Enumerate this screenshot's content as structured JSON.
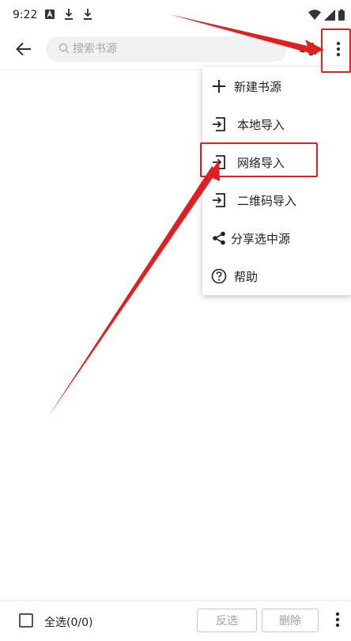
{
  "status_bar": {
    "time": "9:22",
    "left_icons": [
      "a-notification-icon",
      "download-icon",
      "download-icon"
    ],
    "right_icons": [
      "wifi-icon",
      "signal-icon",
      "battery-icon"
    ]
  },
  "toolbar": {
    "search_placeholder": "搜索书源",
    "icons": [
      "back-arrow-icon",
      "search-icon",
      "group-icon",
      "more-vert-icon"
    ]
  },
  "menu": {
    "items": [
      {
        "label": "新建书源",
        "icon": "plus-icon"
      },
      {
        "label": "本地导入",
        "icon": "import-icon"
      },
      {
        "label": "网络导入",
        "icon": "import-icon"
      },
      {
        "label": "二维码导入",
        "icon": "import-icon"
      },
      {
        "label": "分享选中源",
        "icon": "share-icon"
      },
      {
        "label": "帮助",
        "icon": "help-icon"
      }
    ]
  },
  "bottom_bar": {
    "select_all_label": "全选(0/0)",
    "invert_label": "反选",
    "delete_label": "删除"
  },
  "colors": {
    "annotation": "#e02020",
    "search_bg": "#f1f1f1",
    "text": "#222222",
    "disabled_text": "#a0a0a0"
  }
}
